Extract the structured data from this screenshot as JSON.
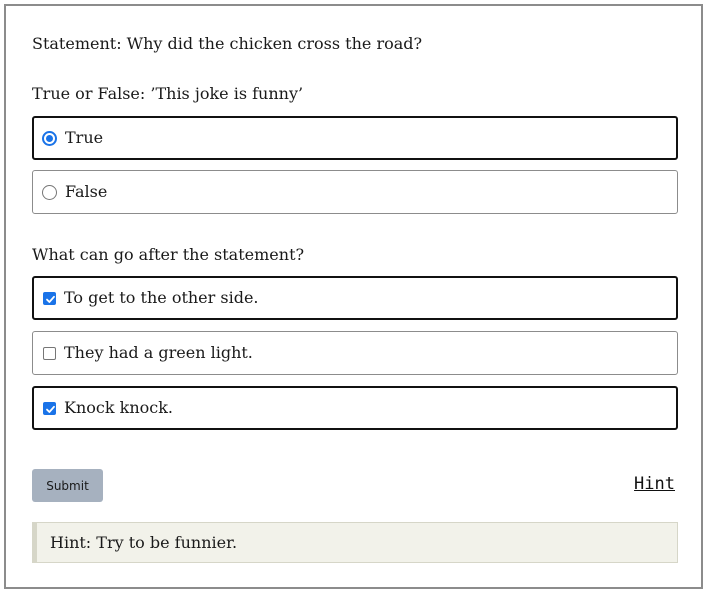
{
  "statement": "Statement: Why did the chicken cross the road?",
  "question1": {
    "prompt": "True or False: ’This joke is funny’",
    "options": [
      {
        "label": "True",
        "checked": true
      },
      {
        "label": "False",
        "checked": false
      }
    ]
  },
  "question2": {
    "prompt": "What can go after the statement?",
    "options": [
      {
        "label": "To get to the other side.",
        "checked": true
      },
      {
        "label": "They had a green light.",
        "checked": false
      },
      {
        "label": "Knock knock.",
        "checked": true
      }
    ]
  },
  "actions": {
    "submit_label": "Submit",
    "hint_link_label": "Hint"
  },
  "hint": {
    "text": "Hint: Try to be funnier."
  },
  "colors": {
    "accent": "#1a73e8",
    "submit_bg": "#a6b1bf",
    "hint_bg": "#f2f2ea"
  }
}
